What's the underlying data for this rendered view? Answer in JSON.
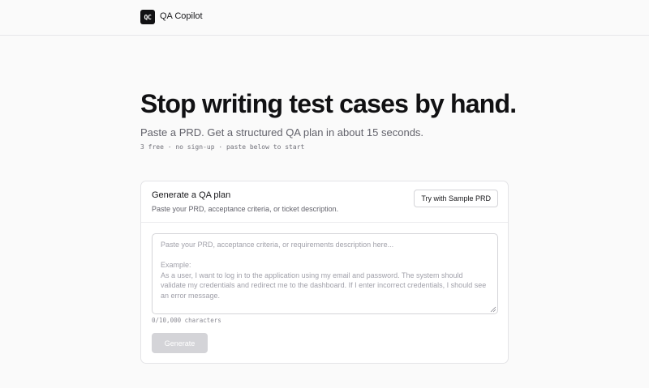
{
  "header": {
    "logo_text": "QC",
    "brand": "QA Copilot"
  },
  "hero": {
    "title": "Stop writing test cases by hand.",
    "subtitle": "Paste a PRD. Get a structured QA plan in about 15 seconds.",
    "meta": "3 free · no sign-up · paste below to start"
  },
  "card": {
    "title": "Generate a QA plan",
    "description": "Paste your PRD, acceptance criteria, or ticket description.",
    "sample_button": "Try with Sample PRD",
    "textarea": {
      "value": "",
      "placeholder": "Paste your PRD, acceptance criteria, or requirements description here...\n\nExample:\nAs a user, I want to log in to the application using my email and password. The system should validate my credentials and redirect me to the dashboard. If I enter incorrect credentials, I should see an error message."
    },
    "char_count": "0/10,000 characters",
    "generate_button": "Generate"
  },
  "colors": {
    "background": "#fafafa",
    "primary_text": "#18181b",
    "muted_text": "#62626b",
    "disabled_button": "#d4d4d8",
    "logo_bg": "#111113"
  }
}
